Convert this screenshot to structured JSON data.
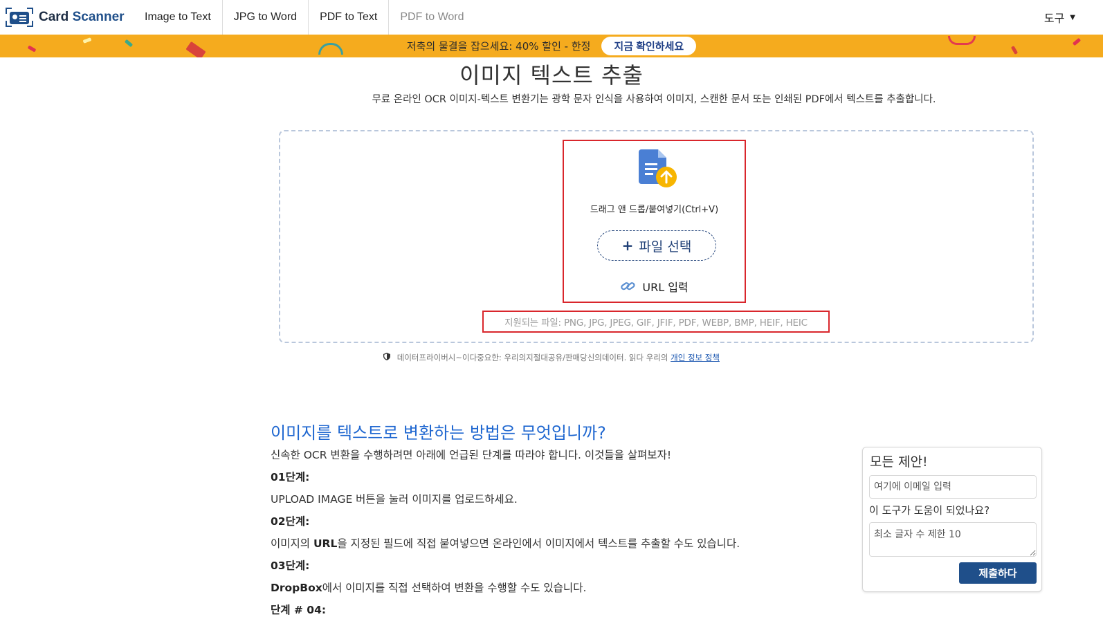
{
  "nav": {
    "brand_part1": "Card",
    "brand_part2": "Scanner",
    "links": [
      "Image to Text",
      "JPG to Word",
      "PDF to Text",
      "PDF to Word"
    ],
    "tools_label": "도구",
    "tools_caret": "▼"
  },
  "promo": {
    "text": "저축의 물결을 잡으세요: 40% 할인 - 한정",
    "button": "지금 확인하세요",
    "color": "#f5ab1e"
  },
  "hero": {
    "title": "이미지 텍스트 추출",
    "subtitle": "무료 온라인 OCR 이미지-텍스트 변환기는 광학 문자 인식을 사용하여 이미지, 스캔한 문서 또는 인쇄된 PDF에서 텍스트를 추출합니다."
  },
  "upload": {
    "drag_text": "드래그 앤 드롭/붙여넣기(Ctrl+V)",
    "pick_plus": "+",
    "pick_label": "파일 선택",
    "url_label": "URL 입력",
    "supported": "지원되는 파일: PNG, JPG, JPEG, GIF, JFIF, PDF, WEBP, BMP, HEIF, HEIC"
  },
  "privacy": {
    "text": "데이터프라이버시~이다중요한: 우리의지절대공유/판매당신의데이터. 읽다 우리의",
    "link": "개인 정보 정책"
  },
  "howto": {
    "title": "이미지를 텍스트로 변환하는 방법은 무엇입니까?",
    "intro": "신속한 OCR 변환을 수행하려면 아래에 언급된 단계를 따라야 합니다. 이것들을 살펴보자!",
    "step1_label": "01단계:",
    "step1_text": "UPLOAD IMAGE 버튼을 눌러 이미지를 업로드하세요.",
    "step2_label": "02단계:",
    "step2_pre": "이미지의 ",
    "step2_bold": "URL",
    "step2_post": "을 지정된 필드에 직접 붙여넣으면 온라인에서 이미지에서 텍스트를 추출할 수도 있습니다.",
    "step3_label": "03단계:",
    "step3_bold": "DropBox",
    "step3_post": "에서 이미지를 직접 선택하여 변환을 수행할 수도 있습니다.",
    "step4_label": "단계 # 04:"
  },
  "feedback": {
    "title": "모든 제안!",
    "email_placeholder": "여기에 이메일 입력",
    "question": "이 도구가 도움이 되었나요?",
    "text_placeholder": "최소 글자 수 제한 10",
    "submit": "제출하다"
  },
  "colors": {
    "brand": "#1f4f8a",
    "accent_blue": "#1f67d0",
    "highlight_red": "#d9262c"
  }
}
